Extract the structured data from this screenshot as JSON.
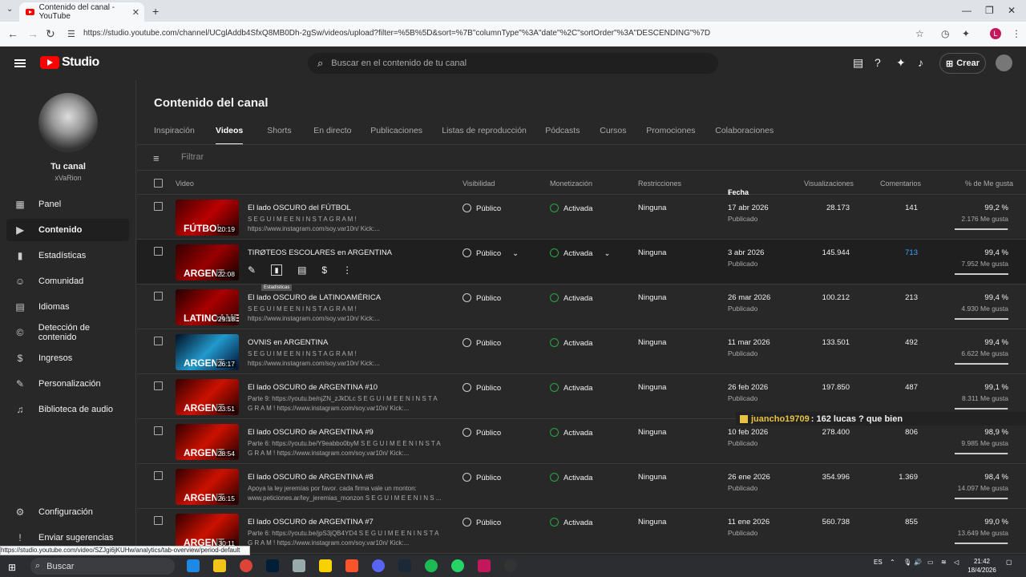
{
  "browser": {
    "tab_title": "Contenido del canal - YouTube",
    "url": "https://studio.youtube.com/channel/UCglAddb4SfxQ8MB0Dh-2gSw/videos/upload?filter=%5B%5D&sort=%7B\"columnType\"%3A\"date\"%2C\"sortOrder\"%3A\"DESCENDING\"%7D",
    "profile": "L"
  },
  "topbar": {
    "logo": "Studio",
    "search_placeholder": "Buscar en el contenido de tu canal",
    "create": "Crear"
  },
  "channel": {
    "title": "Tu canal",
    "name": "xVaRion"
  },
  "sidebar": [
    {
      "label": "Panel",
      "icon": "dashboard-icon",
      "glyph": "▦"
    },
    {
      "label": "Contenido",
      "icon": "content-icon",
      "glyph": "▶"
    },
    {
      "label": "Estadísticas",
      "icon": "analytics-icon",
      "glyph": "▮"
    },
    {
      "label": "Comunidad",
      "icon": "community-icon",
      "glyph": "☺"
    },
    {
      "label": "Idiomas",
      "icon": "subtitles-icon",
      "glyph": "▤"
    },
    {
      "label": "Detección de contenido",
      "icon": "copyright-icon",
      "glyph": "©"
    },
    {
      "label": "Ingresos",
      "icon": "earn-icon",
      "glyph": "$"
    },
    {
      "label": "Personalización",
      "icon": "customization-icon",
      "glyph": "✎"
    },
    {
      "label": "Biblioteca de audio",
      "icon": "audio-library-icon",
      "glyph": "♫"
    },
    {
      "label": "Configuración",
      "icon": "settings-icon",
      "glyph": "⚙"
    },
    {
      "label": "Enviar sugerencias",
      "icon": "feedback-icon",
      "glyph": "!"
    }
  ],
  "page": {
    "title": "Contenido del canal",
    "filter": "Filtrar",
    "tooltip": "Estadísticas"
  },
  "tabs": [
    "Inspiración",
    "Videos",
    "Shorts",
    "En directo",
    "Publicaciones",
    "Listas de reproducción",
    "Pódcasts",
    "Cursos",
    "Promociones",
    "Colaboraciones"
  ],
  "columns": {
    "video": "Video",
    "visibility": "Visibilidad",
    "monetization": "Monetización",
    "restrictions": "Restricciones",
    "date": "Fecha",
    "views": "Visualizaciones",
    "comments": "Comentarios",
    "likes": "% de Me gusta"
  },
  "rows": [
    {
      "title": "El lado OSCURO del FÚTBOL",
      "desc1": "S E G U I M E E N I N S T A G R A M !",
      "desc2": "https://www.instagram.com/soy.var10n/ Kick:...",
      "thumb": "FÚTBOL",
      "duration": "20:19",
      "visibility": "Público",
      "monetization": "Activada",
      "restrictions": "Ninguna",
      "date": "17 abr 2026",
      "status": "Publicado",
      "views": "28.173",
      "comments": "141",
      "likes_pct": "99,2 %",
      "likes": "2.176 Me gusta",
      "like_ratio": 0.992
    },
    {
      "title": "TIRØTEOS ESCOLARES en ARGENTINA",
      "desc1": "",
      "desc2": "",
      "thumb": "ARGENT",
      "duration": "22:08",
      "visibility": "Público",
      "monetization": "Activada",
      "restrictions": "Ninguna",
      "date": "3 abr 2026",
      "status": "Publicado",
      "views": "145.944",
      "comments": "713",
      "likes_pct": "99,4 %",
      "likes": "7.952 Me gusta",
      "like_ratio": 0.994
    },
    {
      "title": "El lado OSCURO de LATINOAMÉRICA",
      "desc1": "S E G U I M E E N I N S T A G R A M !",
      "desc2": "https://www.instagram.com/soy.var10n/ Kick:...",
      "thumb": "LATINOAME",
      "duration": "29:18",
      "visibility": "Público",
      "monetization": "Activada",
      "restrictions": "Ninguna",
      "date": "26 mar 2026",
      "status": "Publicado",
      "views": "100.212",
      "comments": "213",
      "likes_pct": "99,4 %",
      "likes": "4.930 Me gusta",
      "like_ratio": 0.994
    },
    {
      "title": "OVNIS en ARGENTINA",
      "desc1": "S E G U I M E E N I N S T A G R A M !",
      "desc2": "https://www.instagram.com/soy.var10n/ Kick:...",
      "thumb": "ARGENT",
      "duration": "26:17",
      "visibility": "Público",
      "monetization": "Activada",
      "restrictions": "Ninguna",
      "date": "11 mar 2026",
      "status": "Publicado",
      "views": "133.501",
      "comments": "492",
      "likes_pct": "99,4 %",
      "likes": "6.622 Me gusta",
      "like_ratio": 0.994
    },
    {
      "title": "El lado OSCURO de ARGENTINA #10",
      "desc1": "Parte 9: https://youtu.be/njZN_zJkDLc S E G U I M E E N I N S T A",
      "desc2": "G R A M ! https://www.instagram.com/soy.var10n/ Kick:...",
      "thumb": "ARGENT",
      "duration": "23:51",
      "visibility": "Público",
      "monetization": "Activada",
      "restrictions": "Ninguna",
      "date": "26 feb 2026",
      "status": "Publicado",
      "views": "197.850",
      "comments": "487",
      "likes_pct": "99,1 %",
      "likes": "8.311 Me gusta",
      "like_ratio": 0.991
    },
    {
      "title": "El lado OSCURO de ARGENTINA #9",
      "desc1": "Parte 6: https://youtu.be/Y9eabbo0byM S E G U I M E E N I N S T A",
      "desc2": "G R A M ! https://www.instagram.com/soy.var10n/ Kick:...",
      "thumb": "ARGENT",
      "duration": "28:54",
      "visibility": "Público",
      "monetization": "Activada",
      "restrictions": "Ninguna",
      "date": "10 feb 2026",
      "status": "Publicado",
      "views": "278.400",
      "comments": "806",
      "likes_pct": "98,9 %",
      "likes": "9.985 Me gusta",
      "like_ratio": 0.989
    },
    {
      "title": "El lado OSCURO de ARGENTINA #8",
      "desc1": "Apoya la ley jeremías por favor. cada firma vale un monton:",
      "desc2": "www.peticiones.ar/ley_jeremias_monzon S E G U I M E E N I N S ...",
      "thumb": "ARGENT",
      "duration": "26:15",
      "visibility": "Público",
      "monetization": "Activada",
      "restrictions": "Ninguna",
      "date": "26 ene 2026",
      "status": "Publicado",
      "views": "354.996",
      "comments": "1.369",
      "likes_pct": "98,4 %",
      "likes": "14.097 Me gusta",
      "like_ratio": 0.984
    },
    {
      "title": "El lado OSCURO de ARGENTINA #7",
      "desc1": "Parte 6: https://youtu.be/jpS3jQB4YD4 S E G U I M E E N I N S T A",
      "desc2": "G R A M ! https://www.instagram.com/soy.var10n/ Kick:...",
      "thumb": "ARGENT",
      "duration": "30:11",
      "visibility": "Público",
      "monetization": "Activada",
      "restrictions": "Ninguna",
      "date": "11 ene 2026",
      "status": "Publicado",
      "views": "560.738",
      "comments": "855",
      "likes_pct": "99,0 %",
      "likes": "13.649 Me gusta",
      "like_ratio": 0.99
    }
  ],
  "chat": {
    "user": "juancho19709",
    "message": ": 162 lucas ? que bien"
  },
  "statusbar": "https://studio.youtube.com/video/SZJgi6jKUHw/analytics/tab-overview/period-default",
  "taskbar": {
    "search": "Buscar",
    "lang": "ES",
    "time": "21:42",
    "date": "18/4/2026"
  },
  "colors": {
    "accent": "#3ea6ff",
    "monetized": "#2ba640",
    "brand": "#ff0000"
  }
}
